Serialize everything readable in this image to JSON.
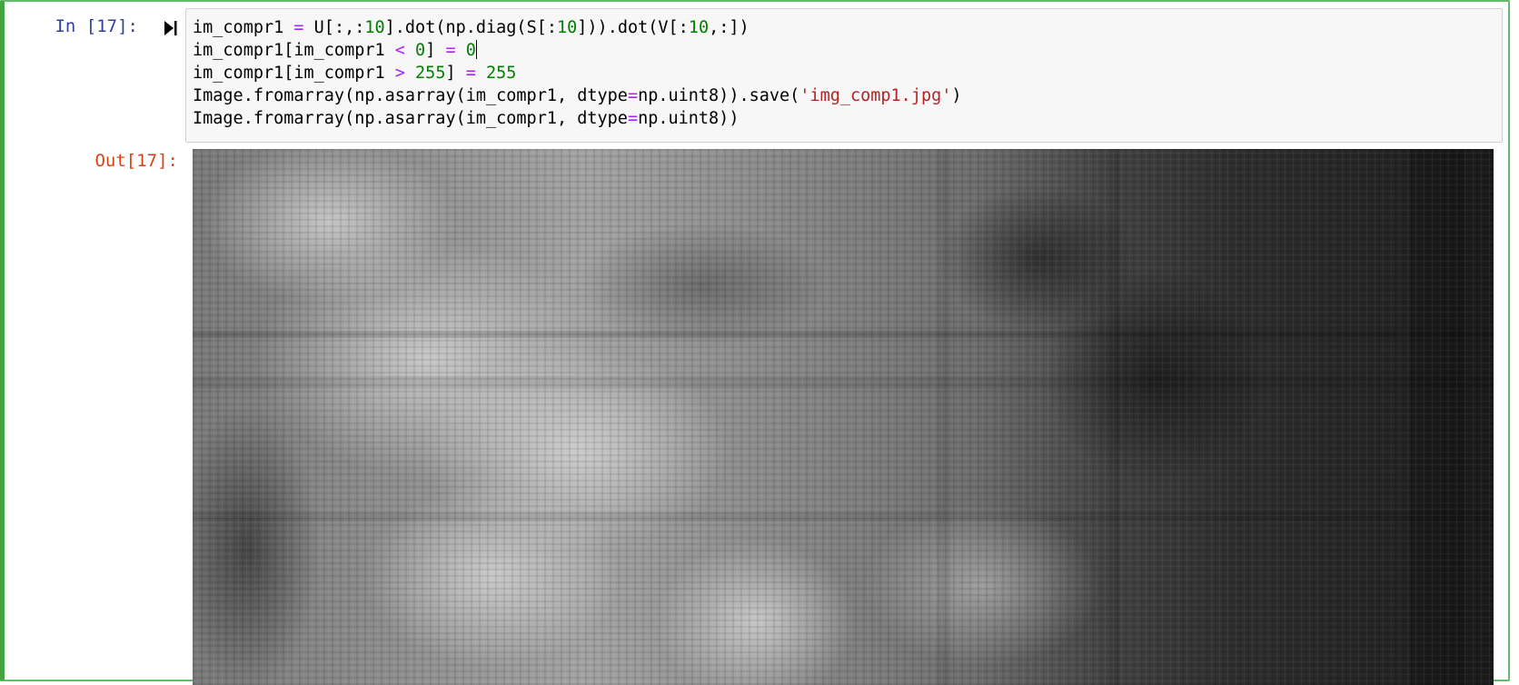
{
  "cell": {
    "in_prompt": "In [17]:",
    "out_prompt": "Out[17]:",
    "run_icon": "run-cell-icon",
    "code_lines": [
      [
        {
          "t": "im_compr1 "
        },
        {
          "t": "=",
          "c": "op"
        },
        {
          "t": " U[:,:"
        },
        {
          "t": "10",
          "c": "num"
        },
        {
          "t": "].dot(np.diag(S[:"
        },
        {
          "t": "10",
          "c": "num"
        },
        {
          "t": "])).dot(V[:"
        },
        {
          "t": "10",
          "c": "num"
        },
        {
          "t": ",:])"
        }
      ],
      [
        {
          "t": "im_compr1[im_compr1 "
        },
        {
          "t": "<",
          "c": "op"
        },
        {
          "t": " "
        },
        {
          "t": "0",
          "c": "num"
        },
        {
          "t": "] "
        },
        {
          "t": "=",
          "c": "op"
        },
        {
          "t": " "
        },
        {
          "t": "0",
          "c": "num"
        },
        {
          "cursor": true
        }
      ],
      [
        {
          "t": "im_compr1[im_compr1 "
        },
        {
          "t": ">",
          "c": "op"
        },
        {
          "t": " "
        },
        {
          "t": "255",
          "c": "num"
        },
        {
          "t": "] "
        },
        {
          "t": "=",
          "c": "op"
        },
        {
          "t": " "
        },
        {
          "t": "255",
          "c": "num"
        }
      ],
      [
        {
          "t": "Image.fromarray(np.asarray(im_compr1, dtype"
        },
        {
          "t": "=",
          "c": "op"
        },
        {
          "t": "np.uint8)).save("
        },
        {
          "t": "'img_comp1.jpg'",
          "c": "str"
        },
        {
          "t": ")"
        }
      ],
      [
        {
          "t": "Image.fromarray(np.asarray(im_compr1, dtype"
        },
        {
          "t": "=",
          "c": "op"
        },
        {
          "t": "np.uint8))"
        }
      ]
    ],
    "colors": {
      "border": "#66bb6a",
      "in_prompt": "#303f9f",
      "out_prompt": "#d84315",
      "number": "#008000",
      "operator": "#aa22ff",
      "string": "#ba2121",
      "input_bg": "#f7f7f7"
    }
  },
  "output_image": {
    "kind": "grayscale-rank-10-svd-reconstruction",
    "tone": "light-left-to-dark-right"
  }
}
